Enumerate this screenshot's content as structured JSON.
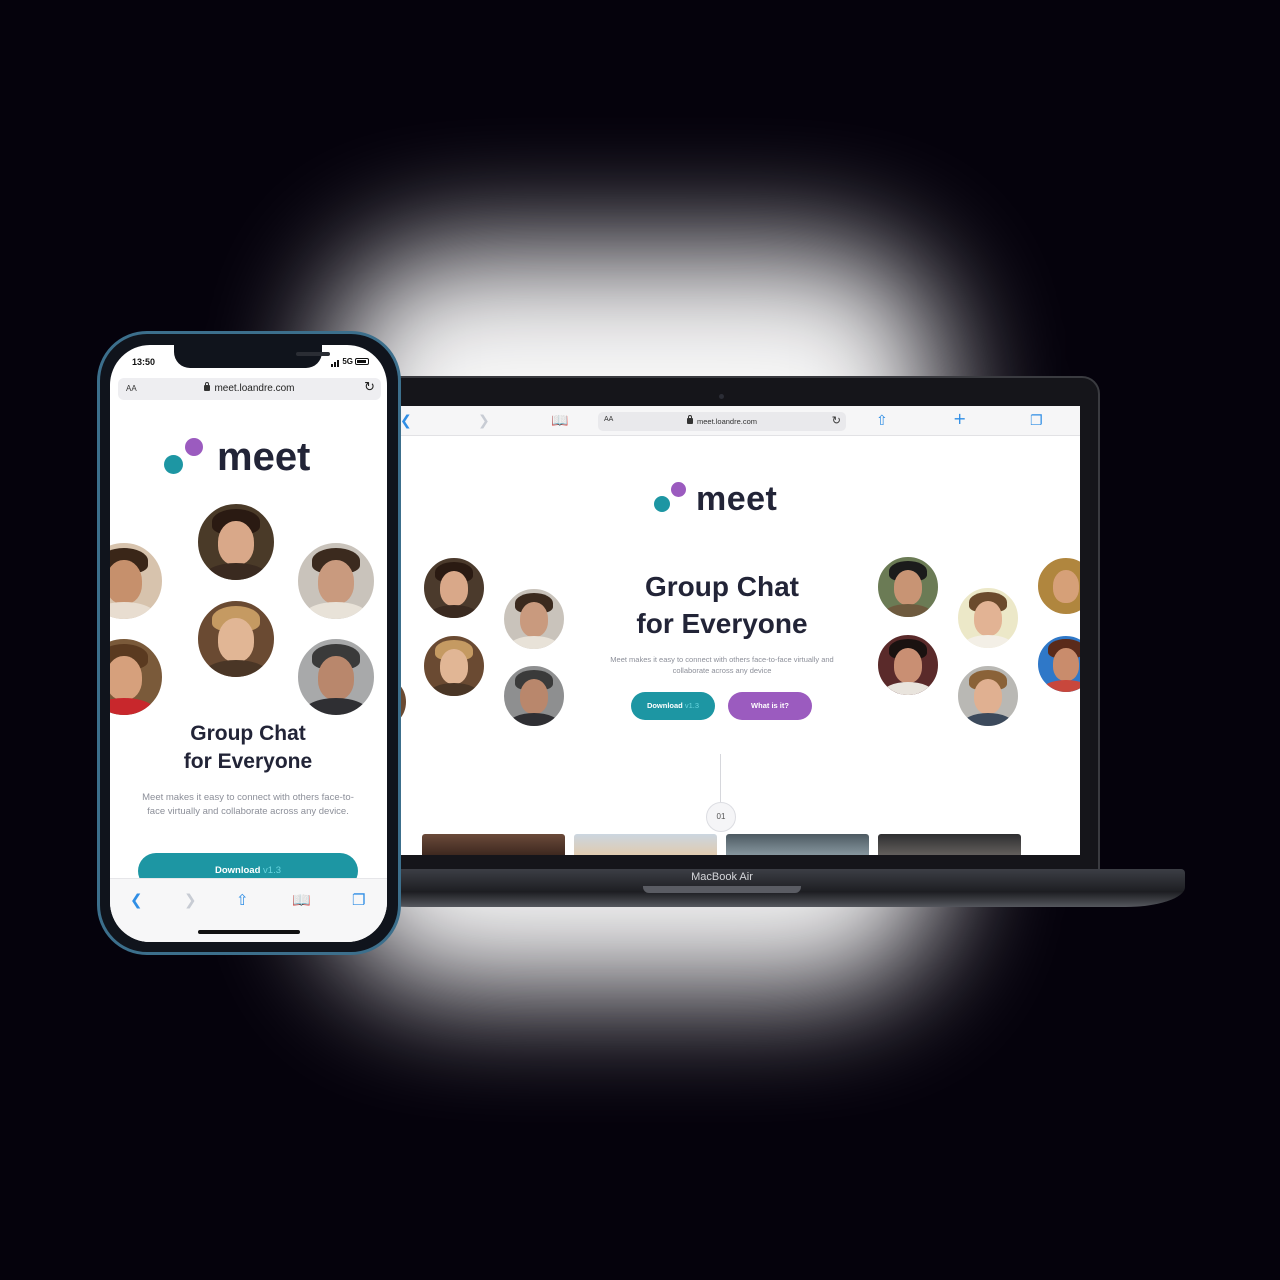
{
  "laptop": {
    "device_label": "MacBook Air",
    "browser": {
      "aa_label": "AA",
      "url": "meet.loandre.com",
      "icons": [
        "back-icon",
        "forward-icon",
        "bookmarks-icon",
        "reload-icon",
        "share-icon",
        "new-tab-icon",
        "tabs-icon"
      ]
    },
    "page": {
      "logo_text": "meet",
      "headline_line1": "Group Chat",
      "headline_line2": "for Everyone",
      "subtext": "Meet makes it easy to connect with others face-to-face virtually and collaborate across any device",
      "download_label": "Download",
      "download_version": "v1.3",
      "what_label": "What is it?",
      "step_number": "01"
    }
  },
  "phone": {
    "status": {
      "time": "13:50",
      "network": "5G"
    },
    "browser": {
      "aa_label": "AA",
      "url": "meet.loandre.com"
    },
    "page": {
      "logo_text": "meet",
      "headline_line1": "Group Chat",
      "headline_line2": "for Everyone",
      "subtext": "Meet makes it easy to connect with others face-to-face virtually and collaborate across any device.",
      "download_label": "Download",
      "download_version": "v1.3"
    },
    "toolbar_icons": [
      "back-icon",
      "forward-icon",
      "share-icon",
      "bookmarks-icon",
      "tabs-icon"
    ]
  },
  "colors": {
    "brand_teal": "#1d96a3",
    "brand_purple": "#9b5bbf",
    "heading": "#222437",
    "ios_blue": "#2f8ee5",
    "background": "#05020c"
  }
}
